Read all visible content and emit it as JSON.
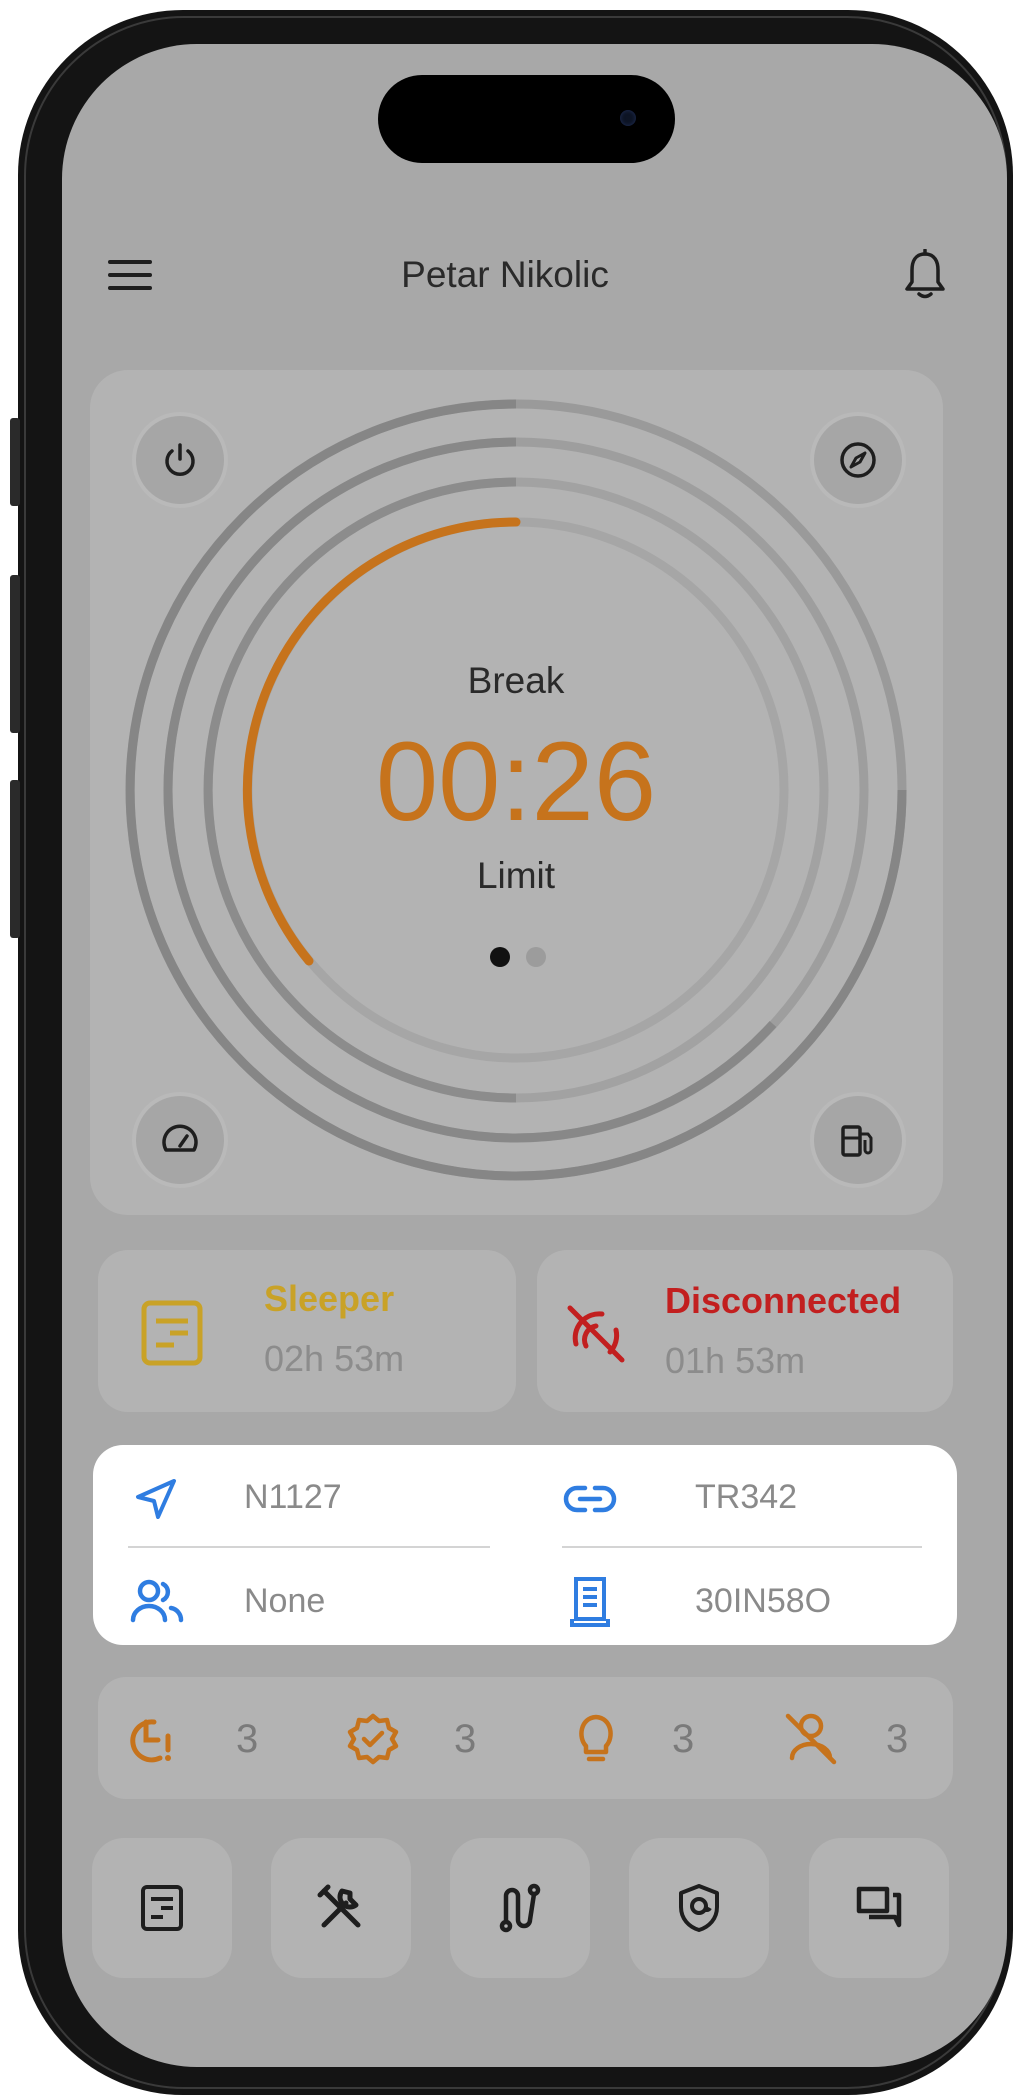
{
  "header": {
    "title": "Petar Nikolic",
    "menu_icon": "hamburger-menu-icon",
    "bell_icon": "bell-icon"
  },
  "timer": {
    "status_label": "Break",
    "time": "00:26",
    "sub_label": "Limit",
    "page_count": 2,
    "active_page": 1,
    "progress_fraction": 0.36,
    "accent_color": "#c6731c",
    "corner_icons": [
      "power-icon",
      "compass-icon",
      "speedometer-icon",
      "fuel-pump-icon"
    ]
  },
  "status_cards": [
    {
      "title": "Sleeper",
      "duration": "02h 53m",
      "color": "#c9a227",
      "icon": "sleeper-log-icon"
    },
    {
      "title": "Disconnected",
      "duration": "01h 53m",
      "color": "#c21f1f",
      "icon": "disconnected-signal-icon"
    }
  ],
  "info": {
    "vehicle": "N1127",
    "trailer": "TR342",
    "co_driver": "None",
    "shipping_doc": "30IN58O",
    "icon_color": "#2f7de1"
  },
  "stats": [
    {
      "icon": "violation-timer-icon",
      "count": "3"
    },
    {
      "icon": "certified-badge-icon",
      "count": "3"
    },
    {
      "icon": "lightbulb-icon",
      "count": "3"
    },
    {
      "icon": "unassigned-driver-icon",
      "count": "3"
    }
  ],
  "bottom_nav": [
    {
      "icon": "logs-icon"
    },
    {
      "icon": "tools-icon"
    },
    {
      "icon": "route-icon"
    },
    {
      "icon": "inspection-shield-icon"
    },
    {
      "icon": "messages-icon"
    }
  ]
}
